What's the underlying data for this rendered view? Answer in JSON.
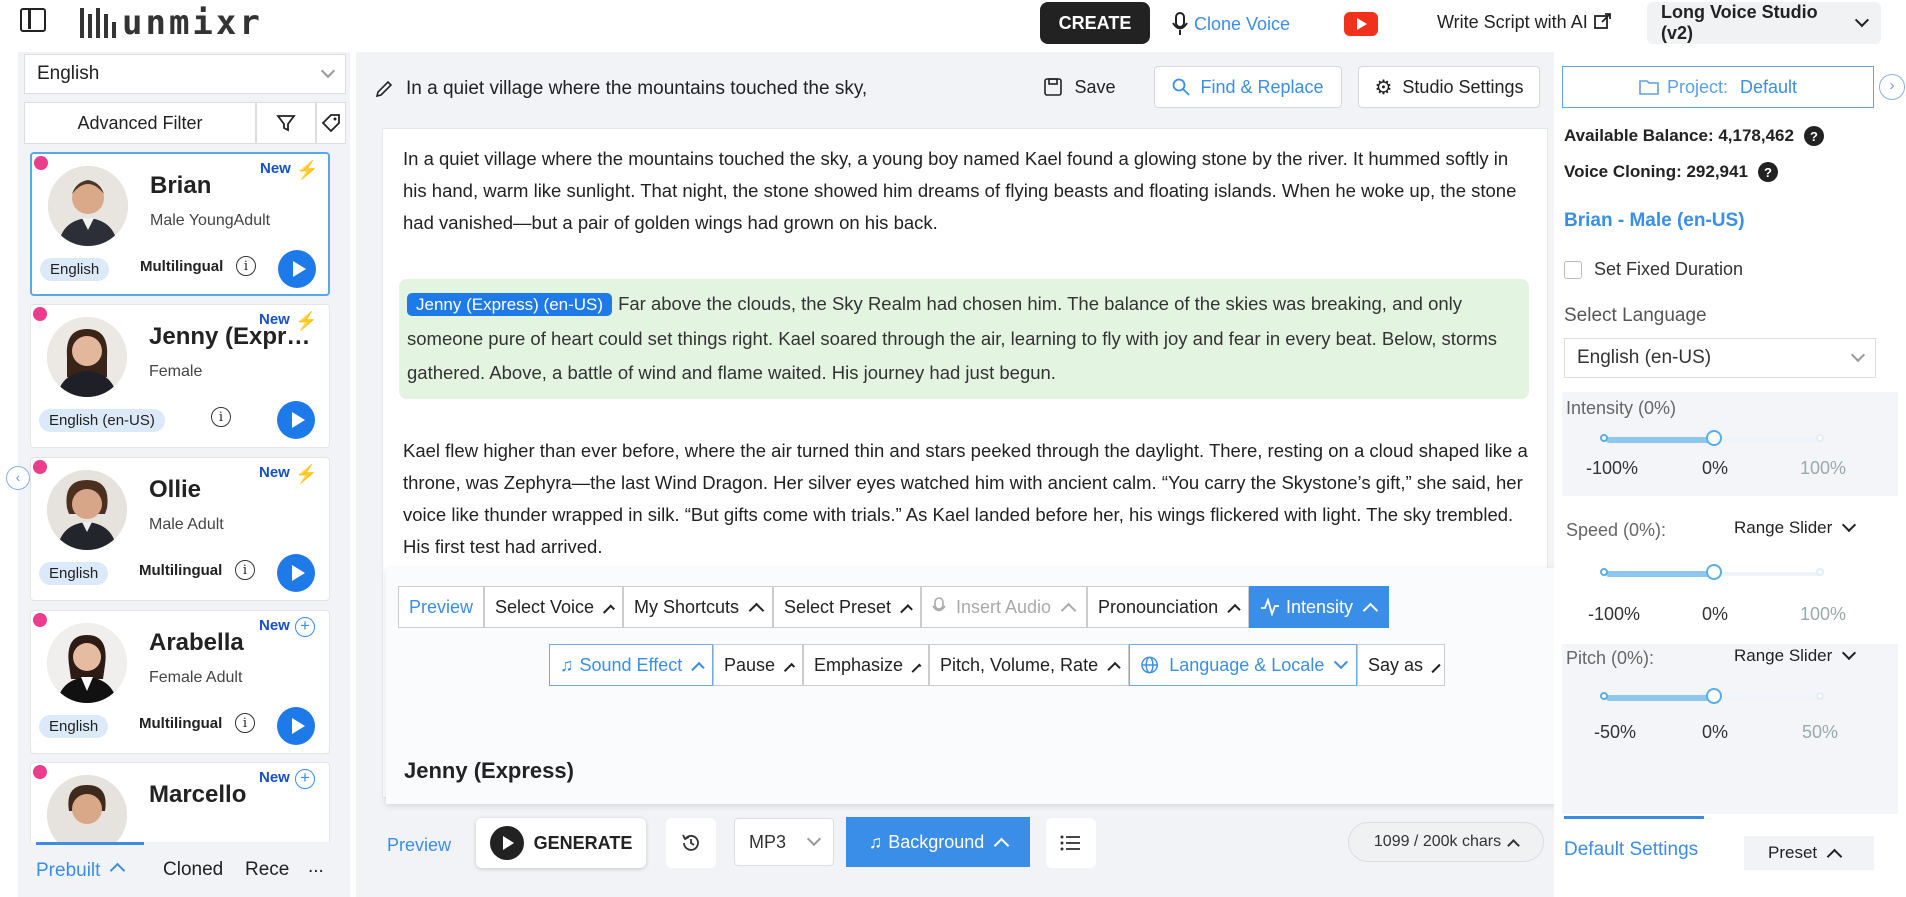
{
  "app": {
    "logo": "unmixr"
  },
  "topbar": {
    "create": "CREATE",
    "clone_voice": "Clone Voice",
    "write_script": "Write Script with AI",
    "studio": "Long Voice Studio (v2)"
  },
  "left": {
    "language": "English",
    "advanced_filter": "Advanced Filter",
    "voices": [
      {
        "name": "Brian",
        "desc": "Male YoungAdult",
        "badge": "New",
        "lang": "English",
        "multi": "Multilingual"
      },
      {
        "name": "Jenny (Express)",
        "desc": "Female",
        "badge": "New",
        "lang": "English (en-US)",
        "multi": ""
      },
      {
        "name": "Ollie",
        "desc": "Male Adult",
        "badge": "New",
        "lang": "English",
        "multi": "Multilingual"
      },
      {
        "name": "Arabella",
        "desc": "Female Adult",
        "badge": "New",
        "lang": "English",
        "multi": "Multilingual"
      },
      {
        "name": "Marcello",
        "desc": "",
        "badge": "New",
        "lang": "",
        "multi": ""
      }
    ],
    "tabs": {
      "prebuilt": "Prebuilt",
      "cloned": "Cloned",
      "recent": "Rece",
      "more": "..."
    }
  },
  "editor": {
    "title": "In a quiet village where the mountains touched the sky,",
    "save": "Save",
    "find_replace": "Find & Replace",
    "studio_settings": "Studio Settings",
    "p1": "In a quiet village where the mountains touched the sky, a young boy named Kael found a glowing stone by the river. It hummed softly in his hand, warm like sunlight. That night, the stone showed him dreams of flying beasts and floating islands. When he woke up, the stone had vanished—but a pair of golden wings had grown on his back.",
    "jenny_tag": "Jenny (Express) (en-US)",
    "p2": "Far above the clouds, the Sky Realm had chosen him. The balance of the skies was breaking, and only someone pure of heart could set things right. Kael soared through the air, learning to fly with joy and fear in every beat. Below, storms gathered. Above, a battle of wind and flame waited. His journey had just begun.",
    "p3": "Kael flew higher than ever before, where the air turned thin and stars peeked through the daylight. There, resting on a cloud shaped like a throne, was Zephyra—the last Wind Dragon. Her silver eyes watched him with ancient calm. “You carry the Skystone’s gift,” she said, her voice like thunder wrapped in silk. “But gifts come with trials.” As Kael landed before her, his wings flickered with light. The sky trembled. His first test had arrived."
  },
  "ssml": {
    "preview": "Preview",
    "select_voice": "Select Voice",
    "my_shortcuts": "My Shortcuts",
    "select_preset": "Select Preset",
    "insert_audio": "Insert Audio",
    "pronounciation": "Pronounciation",
    "intensity": "Intensity",
    "sound_effect": "Sound Effect",
    "pause": "Pause",
    "emphasize": "Emphasize",
    "pitch_volume_rate": "Pitch, Volume, Rate",
    "language_locale": "Language & Locale",
    "say_as": "Say as",
    "current_voice": "Jenny (Express)"
  },
  "bottom": {
    "preview": "Preview",
    "generate": "GENERATE",
    "format": "MP3",
    "background": "Background",
    "chars": "1099 / 200k chars"
  },
  "right": {
    "project_label": "Project:",
    "project_value": "Default",
    "balance": "Available Balance: 4,178,462",
    "cloning": "Voice Cloning: 292,941",
    "voice": "Brian - Male (en-US)",
    "fixed_duration": "Set Fixed Duration",
    "select_language": "Select Language",
    "language": "English (en-US)",
    "intensity_title": "Intensity (0%)",
    "intensity_labels": [
      "-100%",
      "0%",
      "100%"
    ],
    "speed_title": "Speed (0%):",
    "pitch_title": "Pitch (0%):",
    "range_slider": "Range Slider",
    "speed_labels": [
      "-100%",
      "0%",
      "100%"
    ],
    "pitch_labels": [
      "-50%",
      "0%",
      "50%"
    ],
    "default_settings": "Default Settings",
    "preset": "Preset"
  },
  "colors": {
    "accent": "#1e7ae8",
    "link": "#3a8ee6",
    "dark": "#222222",
    "green": "#e3f4e1",
    "pink": "#ec3d8d"
  }
}
